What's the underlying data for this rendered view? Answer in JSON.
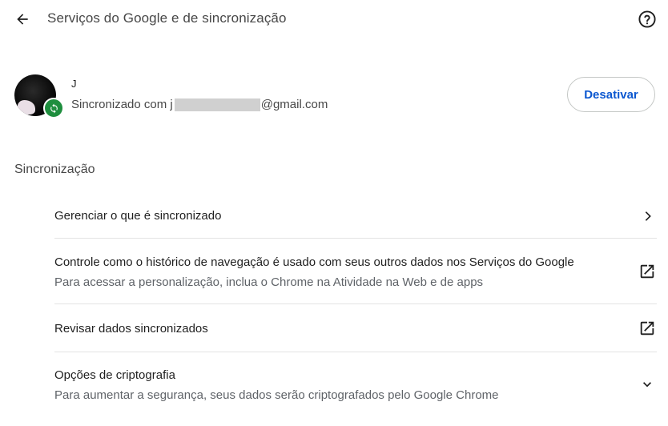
{
  "header": {
    "title": "Serviços do Google e de sincronização",
    "back_icon": "arrow-back-icon",
    "help_icon": "help-circle-icon"
  },
  "account": {
    "name": "J",
    "email_prefix": "Sincronizado com j",
    "email_suffix": "@gmail.com",
    "disable_label": "Desativar",
    "badge_color": "#1e8e3e",
    "accent_color": "#0b57d0"
  },
  "sync_section": {
    "title": "Sincronização",
    "items": [
      {
        "label": "Gerenciar o que é sincronizado",
        "sublabel": "",
        "icon": "chevron-right-icon"
      },
      {
        "label": "Controle como o histórico de navegação é usado com seus outros dados nos Serviços do Google",
        "sublabel": "Para acessar a personalização, inclua o Chrome na Atividade na Web e de apps",
        "icon": "open-in-new-icon"
      },
      {
        "label": "Revisar dados sincronizados",
        "sublabel": "",
        "icon": "open-in-new-icon"
      },
      {
        "label": "Opções de criptografia",
        "sublabel": "Para aumentar a segurança, seus dados serão criptografados pelo Google Chrome",
        "icon": "chevron-down-icon"
      }
    ]
  }
}
